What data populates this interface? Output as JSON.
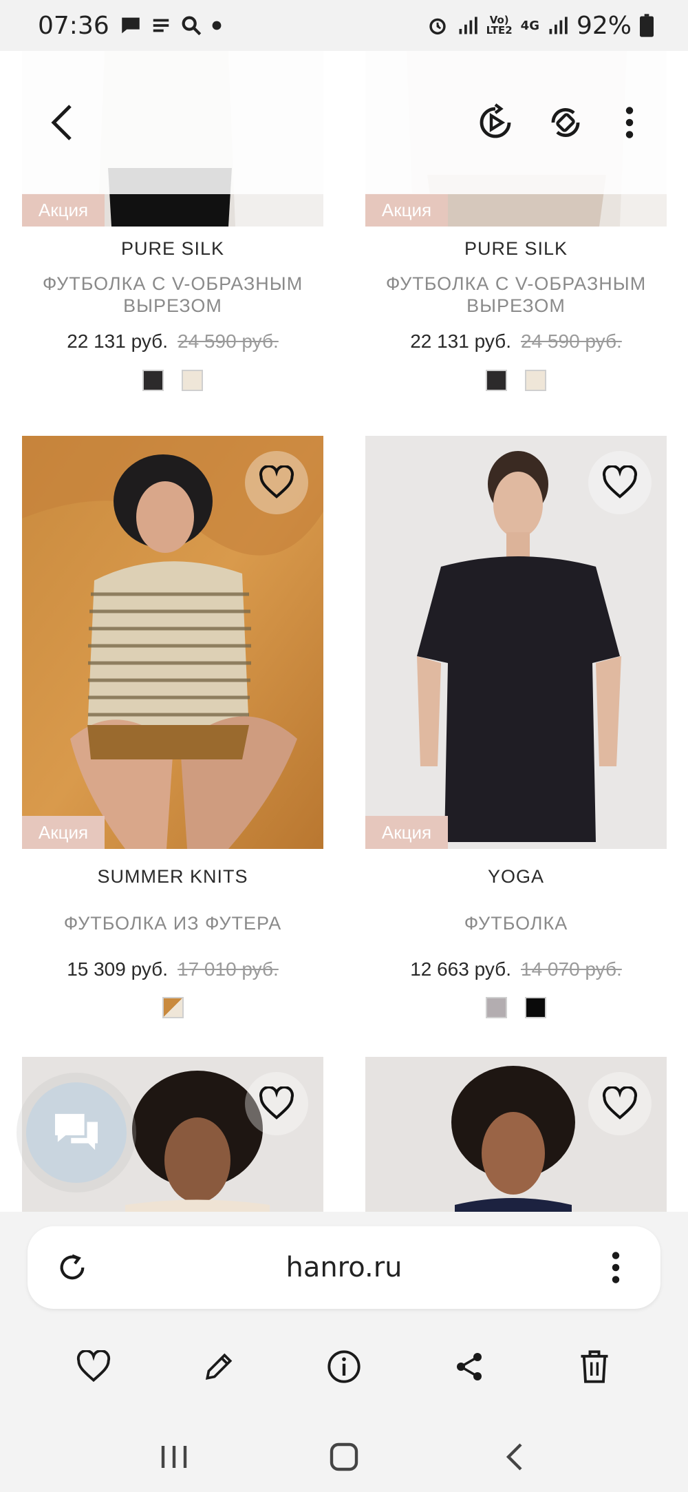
{
  "status_bar": {
    "time": "07:36",
    "network_top": "Vo)",
    "network_bottom": "LTE2",
    "network_gen": "4G",
    "battery": "92%"
  },
  "products": [
    {
      "brand": "PURE SILK",
      "title": "ФУТБОЛКА С V-ОБРАЗНЫМ ВЫРЕЗОМ",
      "price": "22 131 руб.",
      "old_price": "24 590 руб.",
      "sale_label": "Акция",
      "swatches": [
        "#2c2a2b",
        "#efe6d8"
      ]
    },
    {
      "brand": "PURE SILK",
      "title": "ФУТБОЛКА С V-ОБРАЗНЫМ ВЫРЕЗОМ",
      "price": "22 131 руб.",
      "old_price": "24 590 руб.",
      "sale_label": "Акция",
      "swatches": [
        "#2c2a2b",
        "#efe6d8"
      ]
    },
    {
      "brand": "SUMMER KNITS",
      "title": "ФУТБОЛКА ИЗ ФУТЕРА",
      "price": "15 309 руб.",
      "old_price": "17 010 руб.",
      "sale_label": "Акция",
      "swatches": [
        "#c98a3e"
      ]
    },
    {
      "brand": "YOGA",
      "title": "ФУТБОЛКА",
      "price": "12 663 руб.",
      "old_price": "14 070 руб.",
      "sale_label": "Акция",
      "swatches": [
        "#b3adb0",
        "#0a0a0a"
      ]
    }
  ],
  "browser": {
    "url": "hanro.ru"
  },
  "icons": {
    "back": "back-arrow-icon",
    "play": "play-icon",
    "rotate": "rotate-icon",
    "more": "more-vert-icon",
    "heart": "heart-icon",
    "chat": "chat-icon",
    "reload": "reload-icon",
    "edit": "pencil-icon",
    "info": "info-icon",
    "share": "share-icon",
    "delete": "trash-icon",
    "recents": "recents-icon",
    "home": "home-icon",
    "nav_back": "nav-back-icon"
  },
  "colors": {
    "sale_badge": "#e6c7bd",
    "fab": "#c9d5df"
  }
}
